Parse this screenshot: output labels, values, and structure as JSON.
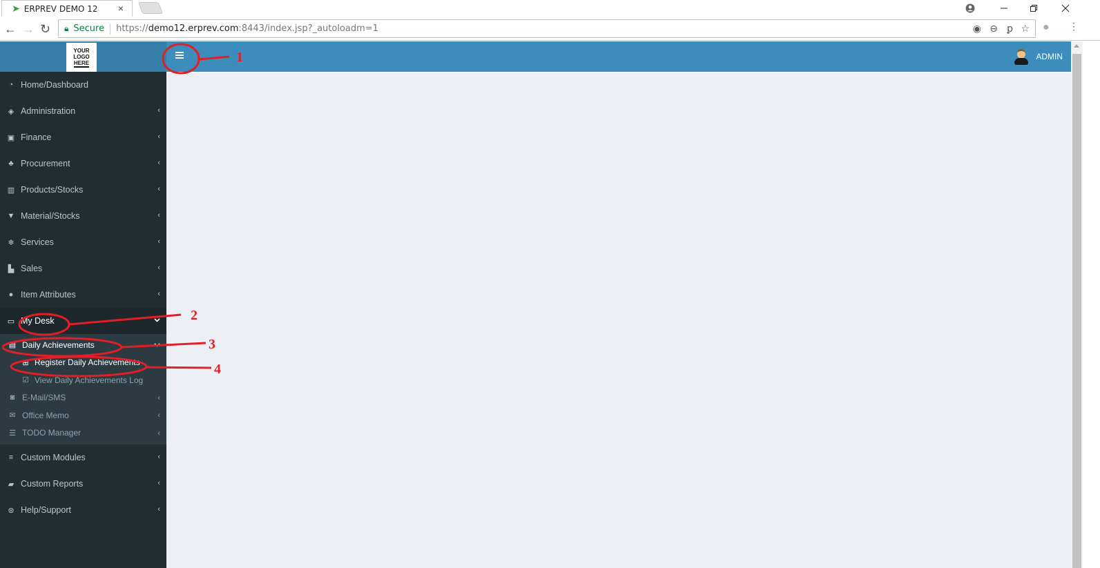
{
  "browser": {
    "tab_title": "ERPREV DEMO 12",
    "tab_favicon": "erprev-bird-icon",
    "tab_close": "×",
    "secure_label": "Secure",
    "url_scheme": "https://",
    "url_host": "demo12.erprev.com",
    "url_rest": ":8443/index.jsp?_autoloadm=1",
    "window_controls": [
      "minimize",
      "restore",
      "close"
    ],
    "omnibox_icons": [
      "location-icon",
      "zoom-out-icon",
      "key-icon",
      "star-icon"
    ]
  },
  "app": {
    "logo_lines": [
      "YOUR",
      "LOGO",
      "HERE"
    ],
    "user_name": "ADMIN",
    "colors": {
      "header": "#3c8dbc",
      "logo_bg": "#367fa9",
      "sidebar": "#222d32",
      "sidebar_active": "#1e282c",
      "submenu": "#2c3b41",
      "content_bg": "#ecf0f5",
      "annotation": "#e41e26"
    }
  },
  "sidebar": {
    "items": [
      {
        "label": "Home/Dashboard",
        "icon": "dashboard-icon",
        "chevron": ""
      },
      {
        "label": "Administration",
        "icon": "tag-icon",
        "chevron": "‹"
      },
      {
        "label": "Finance",
        "icon": "money-icon",
        "chevron": "‹"
      },
      {
        "label": "Procurement",
        "icon": "cubes-icon",
        "chevron": "‹"
      },
      {
        "label": "Products/Stocks",
        "icon": "building-icon",
        "chevron": "‹"
      },
      {
        "label": "Material/Stocks",
        "icon": "trash-bin-icon",
        "chevron": "‹"
      },
      {
        "label": "Services",
        "icon": "snowflake-icon",
        "chevron": "‹"
      },
      {
        "label": "Sales",
        "icon": "cart-icon",
        "chevron": "‹"
      },
      {
        "label": "Item Attributes",
        "icon": "spotify-icon",
        "chevron": "‹"
      },
      {
        "label": "My Desk",
        "icon": "desktop-icon",
        "chevron": "⌄"
      }
    ],
    "my_desk_sub": [
      {
        "label": "Daily Achievements",
        "icon": "chart-icon",
        "chevron": "⌄"
      },
      {
        "label": "E-Mail/SMS",
        "icon": "envelope-square-icon",
        "chevron": "‹"
      },
      {
        "label": "Office Memo",
        "icon": "envelope-icon",
        "chevron": "‹"
      },
      {
        "label": "TODO Manager",
        "icon": "server-icon",
        "chevron": "‹"
      }
    ],
    "daily_achievements_sub": [
      {
        "label": "Register Daily Achievements",
        "icon": "calendar-plus-icon"
      },
      {
        "label": "View Daily Achievements Log",
        "icon": "calendar-check-icon"
      }
    ],
    "bottom_items": [
      {
        "label": "Custom Modules",
        "icon": "database-icon",
        "chevron": "‹"
      },
      {
        "label": "Custom Reports",
        "icon": "book-icon",
        "chevron": "‹"
      },
      {
        "label": "Help/Support",
        "icon": "life-ring-icon",
        "chevron": "‹"
      }
    ]
  },
  "annotations": [
    "1",
    "2",
    "3",
    "4"
  ]
}
